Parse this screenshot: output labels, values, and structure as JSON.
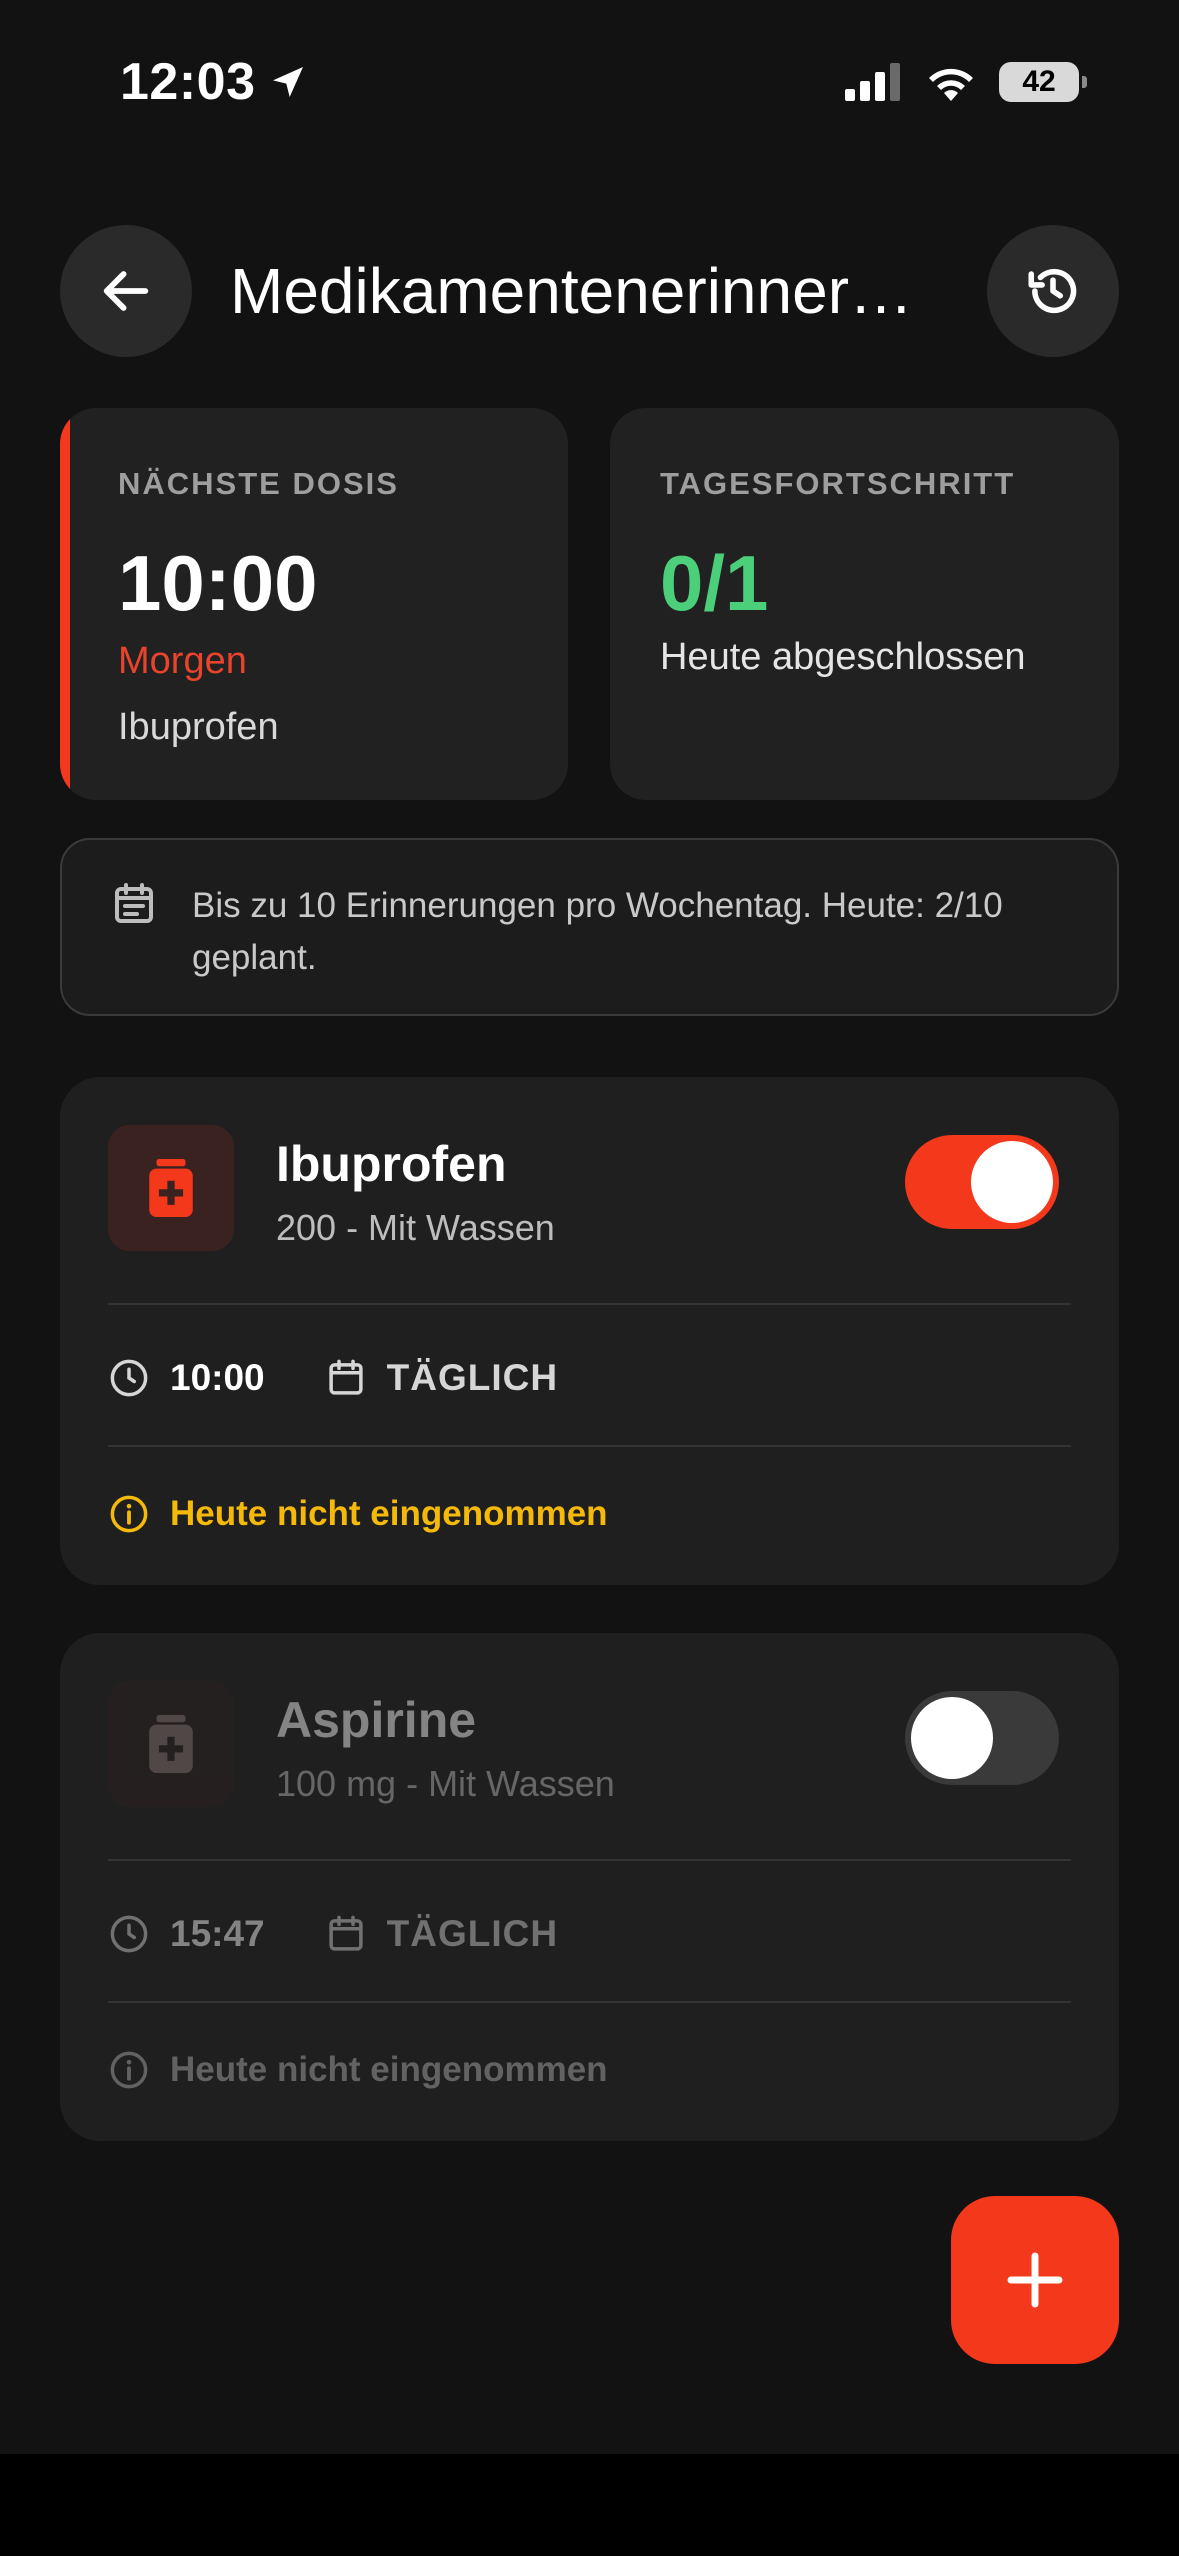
{
  "status_bar": {
    "time": "12:03",
    "battery": "42",
    "icons": [
      "location-arrow-icon",
      "signal-icon",
      "wifi-icon",
      "battery-icon"
    ]
  },
  "header": {
    "title": "Medikamentenerinner…",
    "back_icon": "arrow-left-icon",
    "history_icon": "history-icon"
  },
  "next_dose": {
    "label": "NÄCHSTE DOSIS",
    "time": "10:00",
    "day": "Morgen",
    "medication": "Ibuprofen"
  },
  "daily_progress": {
    "label": "TAGESFORTSCHRITT",
    "value": "0/1",
    "subtitle": "Heute abgeschlossen"
  },
  "info_banner": {
    "icon": "calendar-note-icon",
    "text": "Bis zu 10 Erinnerungen pro Wochentag. Heute: 2/10 geplant."
  },
  "medications": [
    {
      "name": "Ibuprofen",
      "dose": "200 - Mit Wassen",
      "enabled": true,
      "time": "10:00",
      "frequency": "TÄGLICH",
      "status": "Heute nicht eingenommen"
    },
    {
      "name": "Aspirine",
      "dose": "100 mg - Mit Wassen",
      "enabled": false,
      "time": "15:47",
      "frequency": "TÄGLICH",
      "status": "Heute nicht eingenommen"
    }
  ],
  "fab": {
    "icon": "plus-icon"
  },
  "colors": {
    "accent": "#f4381c",
    "success": "#4ccf7a",
    "warning": "#f5b90a",
    "background": "#121212",
    "card": "#212121"
  }
}
